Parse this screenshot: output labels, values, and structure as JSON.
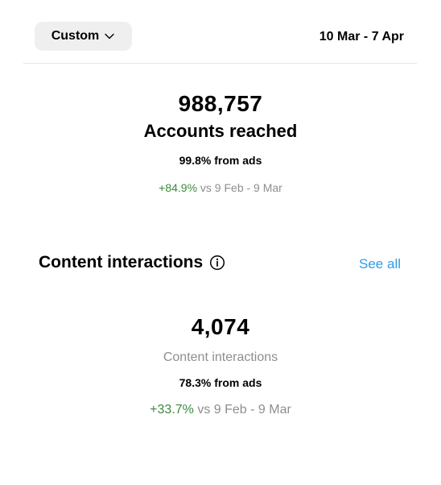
{
  "header": {
    "range_button_label": "Custom",
    "date_range": "10 Mar - 7 Apr"
  },
  "reach": {
    "value": "988,757",
    "label": "Accounts reached",
    "ads_share": "99.8% from ads",
    "change": "+84.9%",
    "comparison": "vs 9 Feb - 9 Mar"
  },
  "interactions_section": {
    "title": "Content interactions",
    "see_all": "See all",
    "value": "4,074",
    "label": "Content interactions",
    "ads_share": "78.3% from ads",
    "change": "+33.7%",
    "comparison": "vs 9 Feb - 9 Mar"
  },
  "colors": {
    "positive": "#3d8a3e",
    "link": "#2d9ce8",
    "muted": "#8e8e8e"
  }
}
